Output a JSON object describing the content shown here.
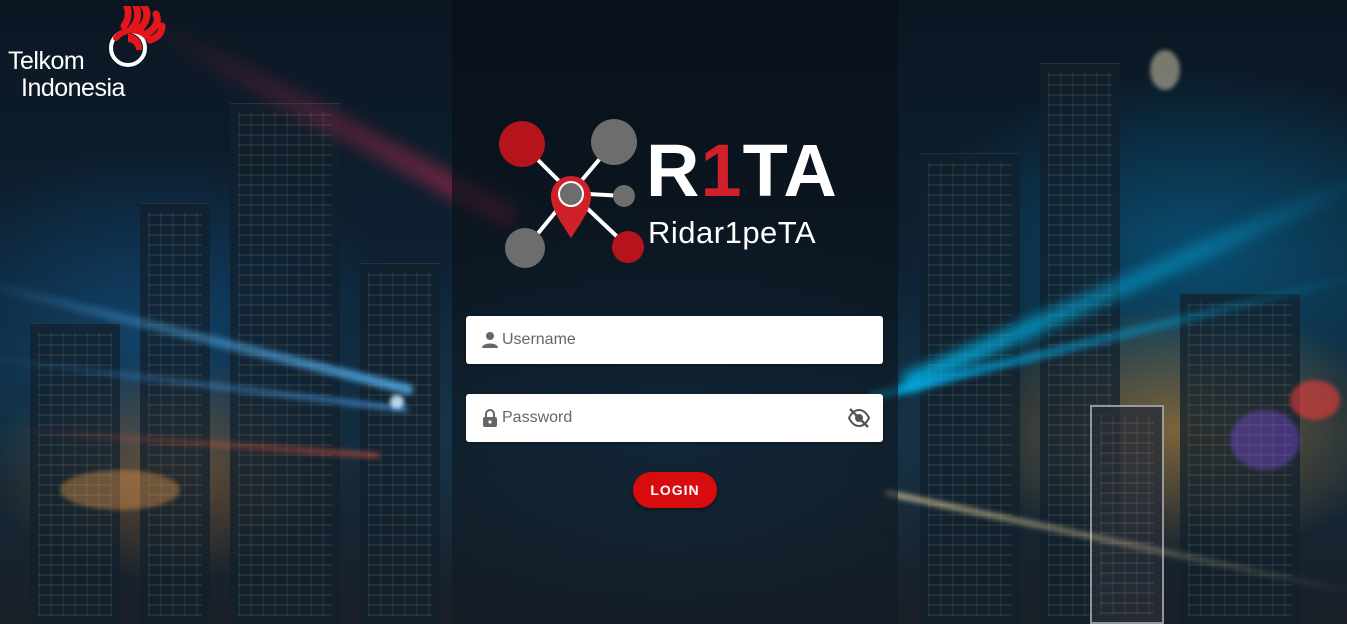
{
  "brand": {
    "company_line1": "Telkom",
    "company_line2": "Indonesia",
    "app_name_r": "R",
    "app_name_one": "1",
    "app_name_rest": "TA",
    "app_subtitle": "Ridar1peTA"
  },
  "login_form": {
    "username_placeholder": "Username",
    "username_value": "",
    "password_placeholder": "Password",
    "password_value": "",
    "login_label": "LOGIN"
  },
  "icons": {
    "username": "user-icon",
    "password": "lock-icon",
    "toggle_password": "eye-slash-icon",
    "telkom_logo": "telkom-hand-logo",
    "rita_logo": "map-pin-network-logo"
  },
  "colors": {
    "accent": "#d80b0f",
    "logo_red": "#b5141c",
    "logo_gray": "#6d6d6d",
    "field_bg": "#ffffff"
  }
}
